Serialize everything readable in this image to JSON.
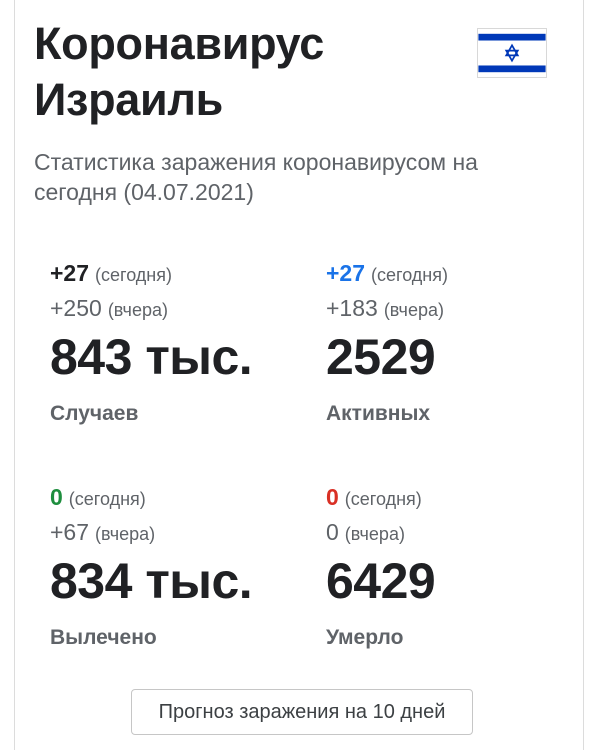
{
  "header": {
    "title_line1": "Коронавирус",
    "title_line2": "Израиль",
    "flag_icon": "israel-flag-icon",
    "subtitle": "Статистика заражения коронавирусом на сегодня (04.07.2021)"
  },
  "stats": {
    "cases": {
      "today_delta": "+27",
      "today_label": "(сегодня)",
      "yesterday_delta": "+250",
      "yesterday_label": "(вчера)",
      "total": "843 тыс.",
      "label": "Случаев",
      "delta_color": "#202124"
    },
    "active": {
      "today_delta": "+27",
      "today_label": "(сегодня)",
      "yesterday_delta": "+183",
      "yesterday_label": "(вчера)",
      "total": "2529",
      "label": "Активных",
      "delta_color": "#1a73e8"
    },
    "recovered": {
      "today_delta": "0",
      "today_label": "(сегодня)",
      "yesterday_delta": "+67",
      "yesterday_label": "(вчера)",
      "total": "834 тыс.",
      "label": "Вылечено",
      "delta_color": "#1e8e3e"
    },
    "deaths": {
      "today_delta": "0",
      "today_label": "(сегодня)",
      "yesterday_delta": "0",
      "yesterday_label": "(вчера)",
      "total": "6429",
      "label": "Умерло",
      "delta_color": "#d93025"
    }
  },
  "forecast_button": {
    "label": "Прогноз заражения на 10 дней"
  },
  "colors": {
    "flag_blue": "#0038b8",
    "text_primary": "#202124",
    "text_secondary": "#5f6368"
  }
}
